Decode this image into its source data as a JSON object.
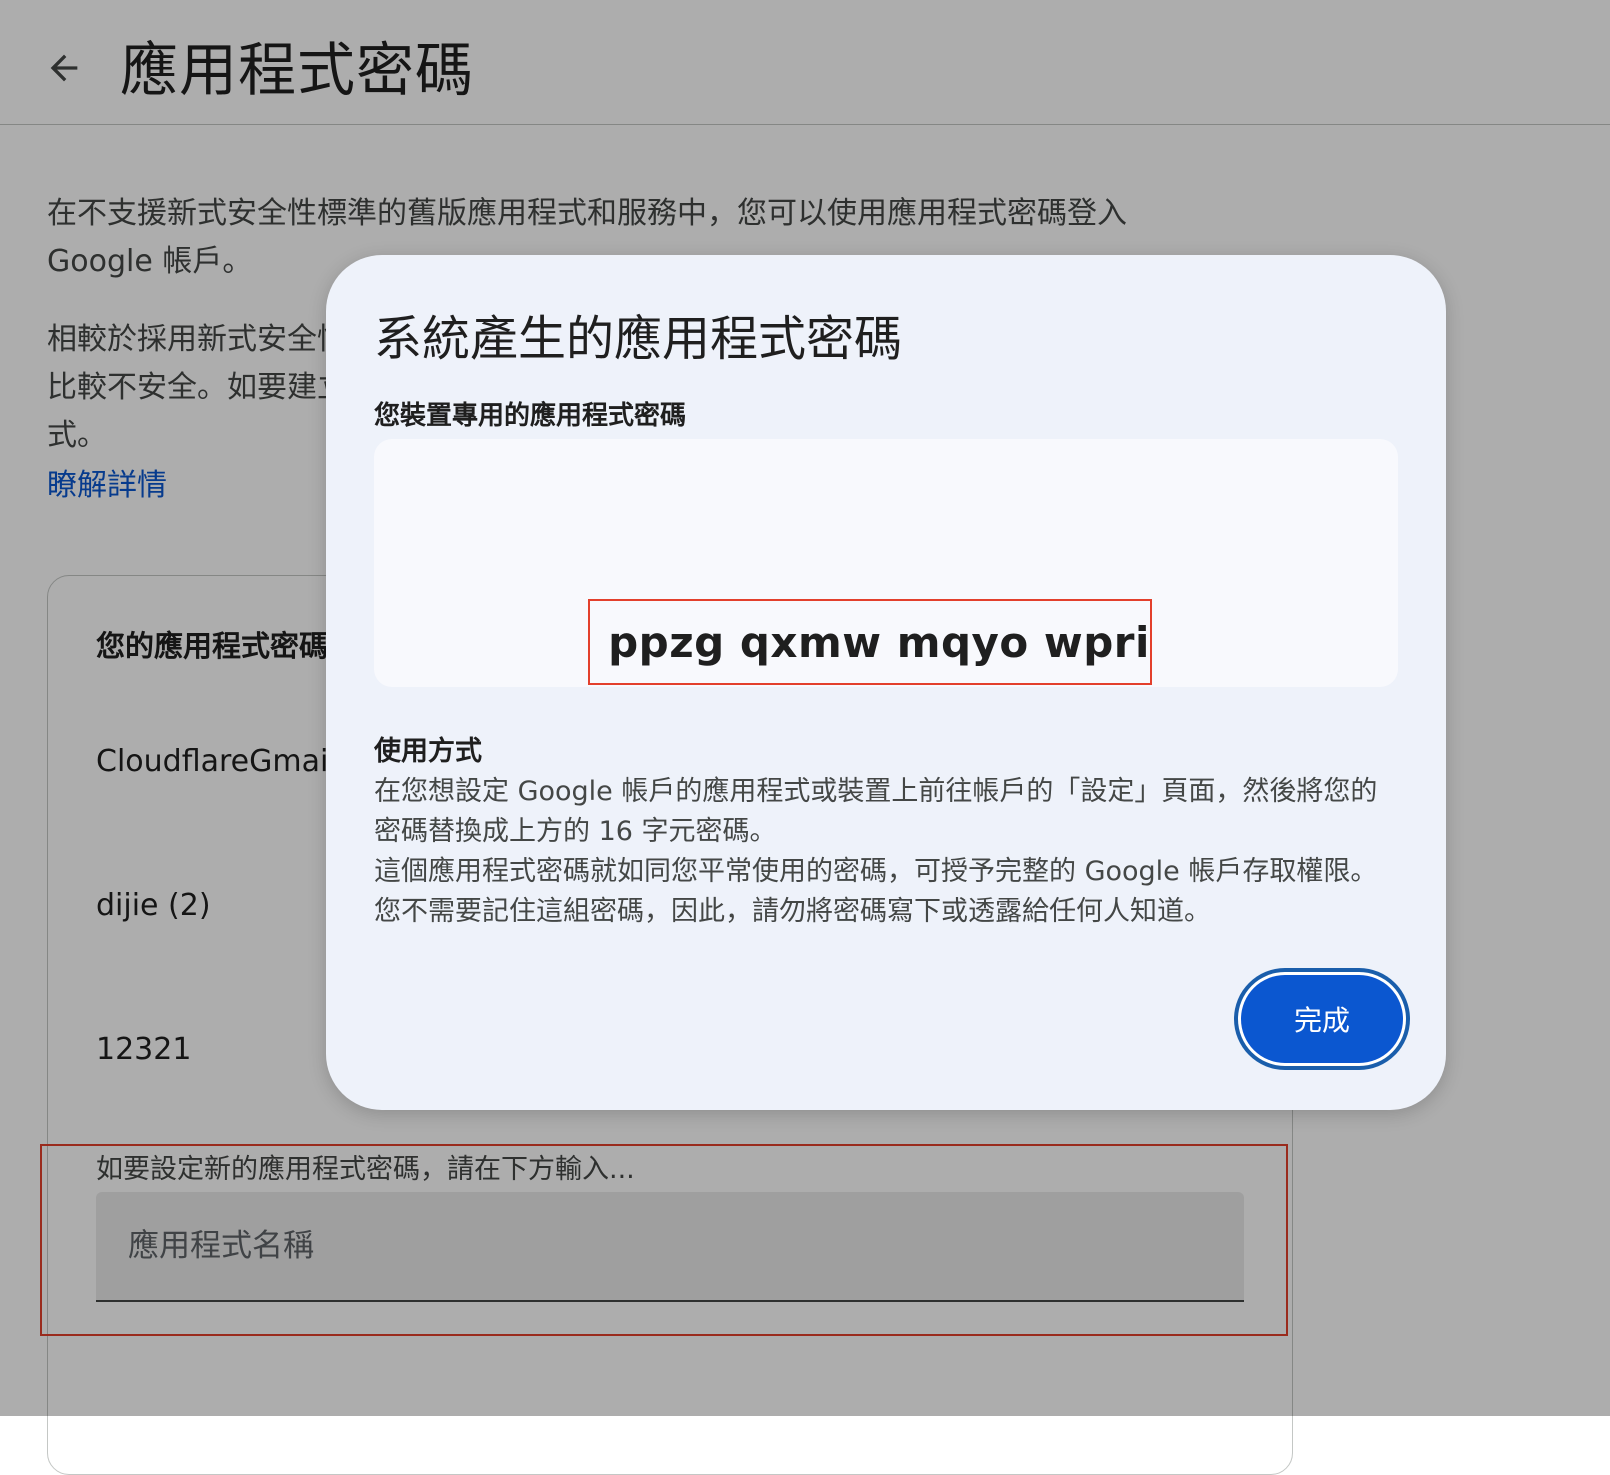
{
  "page": {
    "title": "應用程式密碼",
    "description_1": "在不支援新式安全性標準的舊版應用程式和服務中，您可以使用應用程式密碼登入 Google 帳戶。",
    "description_2": "相較於採用新式安全性標準的應用程式和服務，使用應用程式密碼登入帳戶的方式比較不安全。如要建立應用程式密碼，您必須啟用兩步驟驗證，才能登入應用程式。",
    "learn_more": "瞭解詳情"
  },
  "card": {
    "title": "您的應用程式密碼",
    "items": [
      {
        "name": "CloudflareGmail"
      },
      {
        "name": "dijie (2)"
      },
      {
        "name": "12321"
      }
    ],
    "new_label": "如要設定新的應用程式密碼，請在下方輸入...",
    "input_placeholder": "應用程式名稱"
  },
  "dialog": {
    "title": "系統產生的應用程式密碼",
    "password_label": "您裝置專用的應用程式密碼",
    "password": "ppzg qxmw mqyo wpri",
    "usage_heading": "使用方式",
    "usage_text_1": "在您想設定 Google 帳戶的應用程式或裝置上前往帳戶的「設定」頁面，然後將您的密碼替換成上方的 16 字元密碼。",
    "usage_text_2": "這個應用程式密碼就如同您平常使用的密碼，可授予完整的 Google 帳戶存取權限。您不需要記住這組密碼，因此，請勿將密碼寫下或透露給任何人知道。",
    "done_label": "完成"
  },
  "icons": {
    "back": "arrow-back-icon"
  },
  "colors": {
    "primary": "#0b57d0",
    "highlight_border": "#e3402c",
    "dialog_bg": "#eef2fa",
    "scrim": "rgba(0,0,0,0.32)"
  }
}
